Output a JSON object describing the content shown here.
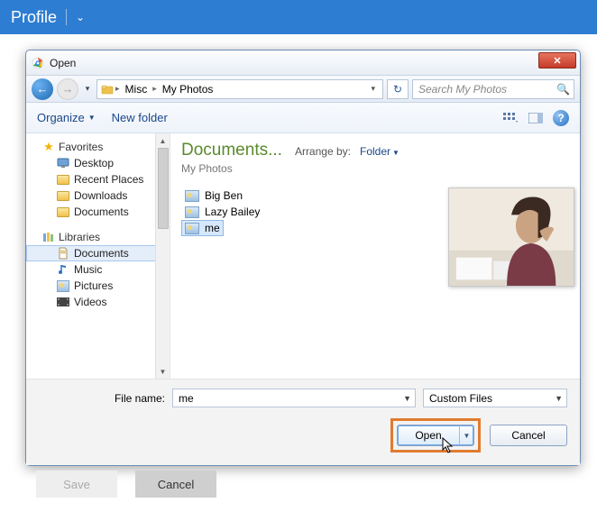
{
  "profile": {
    "label": "Profile"
  },
  "dialog": {
    "title": "Open",
    "breadcrumb": {
      "seg1": "Misc",
      "seg2": "My Photos"
    },
    "search_placeholder": "Search My Photos",
    "toolbar": {
      "organize": "Organize",
      "newfolder": "New folder"
    },
    "location_label": "Documents...",
    "location_sub": "My Photos",
    "arrange_label": "Arrange by:",
    "arrange_value": "Folder",
    "files": [
      {
        "name": "Big Ben"
      },
      {
        "name": "Lazy Bailey"
      },
      {
        "name": "me",
        "selected": true
      }
    ],
    "sidebar": {
      "favorites": "Favorites",
      "fav_items": [
        "Desktop",
        "Recent Places",
        "Downloads",
        "Documents"
      ],
      "libraries": "Libraries",
      "lib_items": [
        "Documents",
        "Music",
        "Pictures",
        "Videos"
      ]
    },
    "filename_label": "File name:",
    "filename_value": "me",
    "filetype_value": "Custom Files",
    "open_btn": "Open",
    "cancel_btn": "Cancel"
  },
  "page_buttons": {
    "save": "Save",
    "cancel": "Cancel"
  }
}
